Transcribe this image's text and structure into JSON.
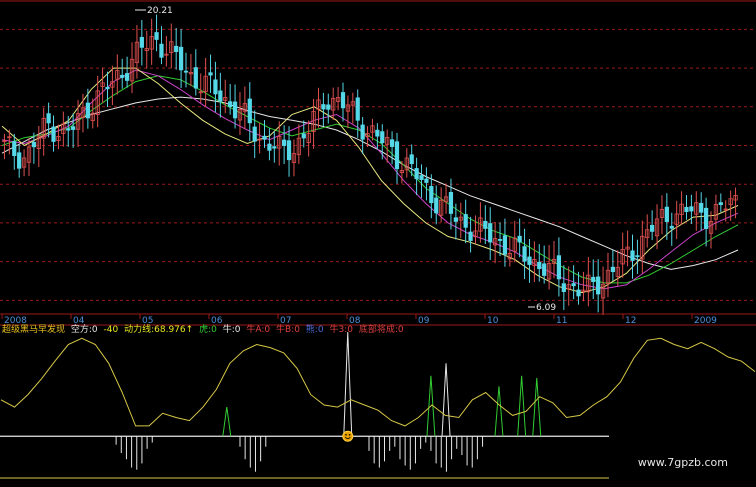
{
  "chart_data": [
    {
      "type": "candlestick",
      "x_ticks": [
        "2008",
        "04",
        "05",
        "06",
        "07",
        "08",
        "09",
        "10",
        "11",
        "12",
        "2009"
      ],
      "annotations": {
        "high_label": "20.21",
        "low_label": "6.09"
      },
      "price_range": [
        5.5,
        21.0
      ],
      "grid": "dashed-red-horizontal",
      "series": [
        {
          "color": "#e8e8e8",
          "values": [
            13.6,
            14.2,
            14.8,
            15.2,
            15.6,
            15.9,
            16.2,
            16.4,
            16.5,
            16.4,
            16.2,
            15.8,
            15.5,
            15.3,
            15.1,
            14.8,
            14.3,
            13.7,
            13.0,
            12.4,
            11.9,
            11.4,
            11.0,
            10.6,
            10.2,
            9.8,
            9.3,
            8.8,
            8.3,
            7.9,
            7.6,
            7.8,
            8.1,
            8.6
          ]
        },
        {
          "color": "#33cc33",
          "values": [
            14.0,
            14.4,
            14.6,
            14.9,
            15.8,
            16.6,
            17.3,
            17.6,
            17.4,
            16.8,
            16.1,
            15.5,
            14.9,
            14.5,
            14.8,
            15.1,
            14.8,
            14.1,
            13.0,
            11.8,
            11.0,
            10.2,
            9.6,
            9.2,
            8.5,
            7.8,
            7.2,
            6.9,
            6.9,
            7.3,
            7.9,
            8.6,
            9.3,
            9.9
          ]
        },
        {
          "color": "#cc44cc",
          "values": [
            14.3,
            14.1,
            14.5,
            15.0,
            16.2,
            17.3,
            17.9,
            17.6,
            16.9,
            16.1,
            15.4,
            14.8,
            14.3,
            14.8,
            15.3,
            15.6,
            14.9,
            13.6,
            12.2,
            11.0,
            10.0,
            9.4,
            9.0,
            8.5,
            7.8,
            7.2,
            6.8,
            6.6,
            6.8,
            7.6,
            8.5,
            9.4,
            10.0,
            10.5
          ]
        },
        {
          "color": "#e8e880",
          "values": [
            15.0,
            14.0,
            14.6,
            15.3,
            16.9,
            18.0,
            18.0,
            17.2,
            16.2,
            15.3,
            14.6,
            14.1,
            14.5,
            15.6,
            16.0,
            15.3,
            13.9,
            12.2,
            11.0,
            10.0,
            9.3,
            9.0,
            8.6,
            8.1,
            7.3,
            6.7,
            6.4,
            6.7,
            7.4,
            8.6,
            9.6,
            10.3,
            10.4,
            10.9
          ]
        }
      ],
      "candles": [
        13.9,
        13.4,
        15.1,
        14.6,
        16.2,
        17.2,
        18.5,
        19.6,
        18.4,
        17.3,
        16.7,
        15.6,
        14.3,
        13.6,
        14.5,
        16.6,
        15.9,
        14.7,
        13.8,
        12.6,
        11.3,
        10.2,
        9.6,
        9.1,
        8.4,
        7.8,
        7.0,
        6.4,
        7.3,
        8.3,
        9.6,
        10.5,
        10.6,
        10.4,
        11.2
      ]
    },
    {
      "type": "line",
      "indicator": {
        "name": "超级黑马早发现",
        "empty_label": "空方:0",
        "empty_extra": "-40",
        "power_label": "动力线:68.976",
        "power_arrow": "↑",
        "tiger_label": "虎:0",
        "ox_label": "牛:0",
        "oxA_label": "牛A:0",
        "oxB_label": "牛B:0",
        "bear_label": "熊:0",
        "ox3_label": "牛3:0",
        "bottom_label": "底部将成:0"
      },
      "range": [
        -40,
        100
      ],
      "power_line": [
        35,
        28,
        40,
        55,
        72,
        88,
        94,
        88,
        70,
        42,
        10,
        10,
        22,
        18,
        15,
        28,
        45,
        70,
        82,
        88,
        85,
        80,
        65,
        40,
        30,
        28,
        35,
        30,
        25,
        15,
        10,
        18,
        30,
        20,
        18,
        35,
        42,
        30,
        20,
        24,
        38,
        32,
        18,
        20,
        30,
        38,
        52,
        75,
        92,
        94,
        88,
        84,
        90,
        84,
        76,
        72,
        62
      ],
      "spikes": [
        {
          "at": 0.3,
          "value": 28,
          "color": "#33cc33"
        },
        {
          "at": 0.46,
          "value": 100,
          "color": "#e8e8e8"
        },
        {
          "at": 0.57,
          "value": 58,
          "color": "#33cc33"
        },
        {
          "at": 0.59,
          "value": 70,
          "color": "#e8e8e8"
        },
        {
          "at": 0.66,
          "value": 48,
          "color": "#33cc33"
        },
        {
          "at": 0.69,
          "value": 58,
          "color": "#33cc33"
        },
        {
          "at": 0.71,
          "value": 56,
          "color": "#33cc33"
        }
      ],
      "bottom_bars": [
        0,
        0,
        0,
        0,
        0,
        0,
        0,
        0,
        0,
        0,
        0,
        0,
        0,
        0,
        0,
        0,
        0,
        0,
        0,
        0,
        0,
        0,
        -8,
        -16,
        -22,
        -30,
        -32,
        -26,
        -12,
        -6,
        0,
        0,
        0,
        0,
        0,
        0,
        0,
        0,
        0,
        0,
        0,
        0,
        0,
        0,
        0,
        0,
        -10,
        -22,
        -30,
        -34,
        -24,
        -10,
        0,
        0,
        0,
        0,
        0,
        0,
        0,
        0,
        0,
        0,
        0,
        0,
        0,
        0,
        0,
        0,
        0,
        0,
        0,
        -14,
        -26,
        -30,
        -24,
        -14,
        -10,
        -22,
        -28,
        -32,
        -26,
        -12,
        -6,
        -14,
        -26,
        -30,
        -34,
        -22,
        -12,
        -18,
        -28,
        -30,
        -22,
        -10,
        0,
        0,
        0,
        0,
        0,
        0,
        0,
        0,
        0,
        0,
        0,
        0,
        0,
        0,
        0,
        0,
        0,
        0,
        0,
        0,
        0,
        0,
        0,
        0
      ]
    }
  ],
  "watermark": "www.7gpzb.com",
  "colors": {
    "background": "#000000",
    "grid": "#9a1a1a",
    "up_candle": "#e05050",
    "down_candle": "#55d8e8",
    "power_line": "#d8c846",
    "zero_line": "#e8e8e8",
    "axis_text": "#4a90d9",
    "indicator_title": "#e8c020",
    "label_white": "#e8e8e8",
    "label_yellow": "#e8e820",
    "label_green": "#33cc33",
    "label_red": "#e04040",
    "label_blue": "#4a6ad9"
  }
}
